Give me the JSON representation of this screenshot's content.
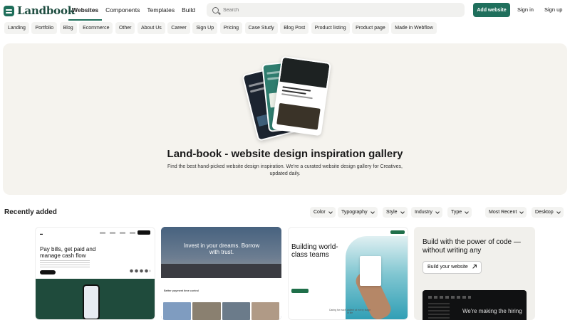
{
  "brand": {
    "name": "Landbook",
    "accent": "#1f6f5c"
  },
  "nav": {
    "links": [
      "Websites",
      "Components",
      "Templates",
      "Build"
    ],
    "active": "Websites",
    "search_placeholder": "Search",
    "add_label": "Add website",
    "signin_label": "Sign in",
    "signup_label": "Sign up"
  },
  "categories": [
    "Landing",
    "Portfolio",
    "Blog",
    "Ecommerce",
    "Other",
    "About Us",
    "Career",
    "Sign Up",
    "Pricing",
    "Case Study",
    "Blog Post",
    "Product listing",
    "Product page",
    "Made in Webflow"
  ],
  "hero": {
    "title": "Land-book - website design inspiration gallery",
    "subtitle": "Find the best hand-picked website design inspiration. We're a curated website design gallery for Creatives, updated daily."
  },
  "recent": {
    "title": "Recently added",
    "filters": [
      "Color",
      "Typography",
      "Style",
      "Industry",
      "Type"
    ],
    "sort": "Most Recent",
    "device": "Desktop"
  },
  "cards": {
    "card1_headline": "Pay bills, get paid and manage cash flow",
    "card2_headline": "Invest in your dreams. Borrow with trust.",
    "card2_sub": "Better payment time control",
    "card3_headline": "Building world-class teams",
    "card3_caption": "Caring for each patient at every stage of life",
    "promo_title": "Build with the power of code — without writing any",
    "promo_button": "Build your website",
    "promo_dark_text": "We're making the hiring"
  }
}
